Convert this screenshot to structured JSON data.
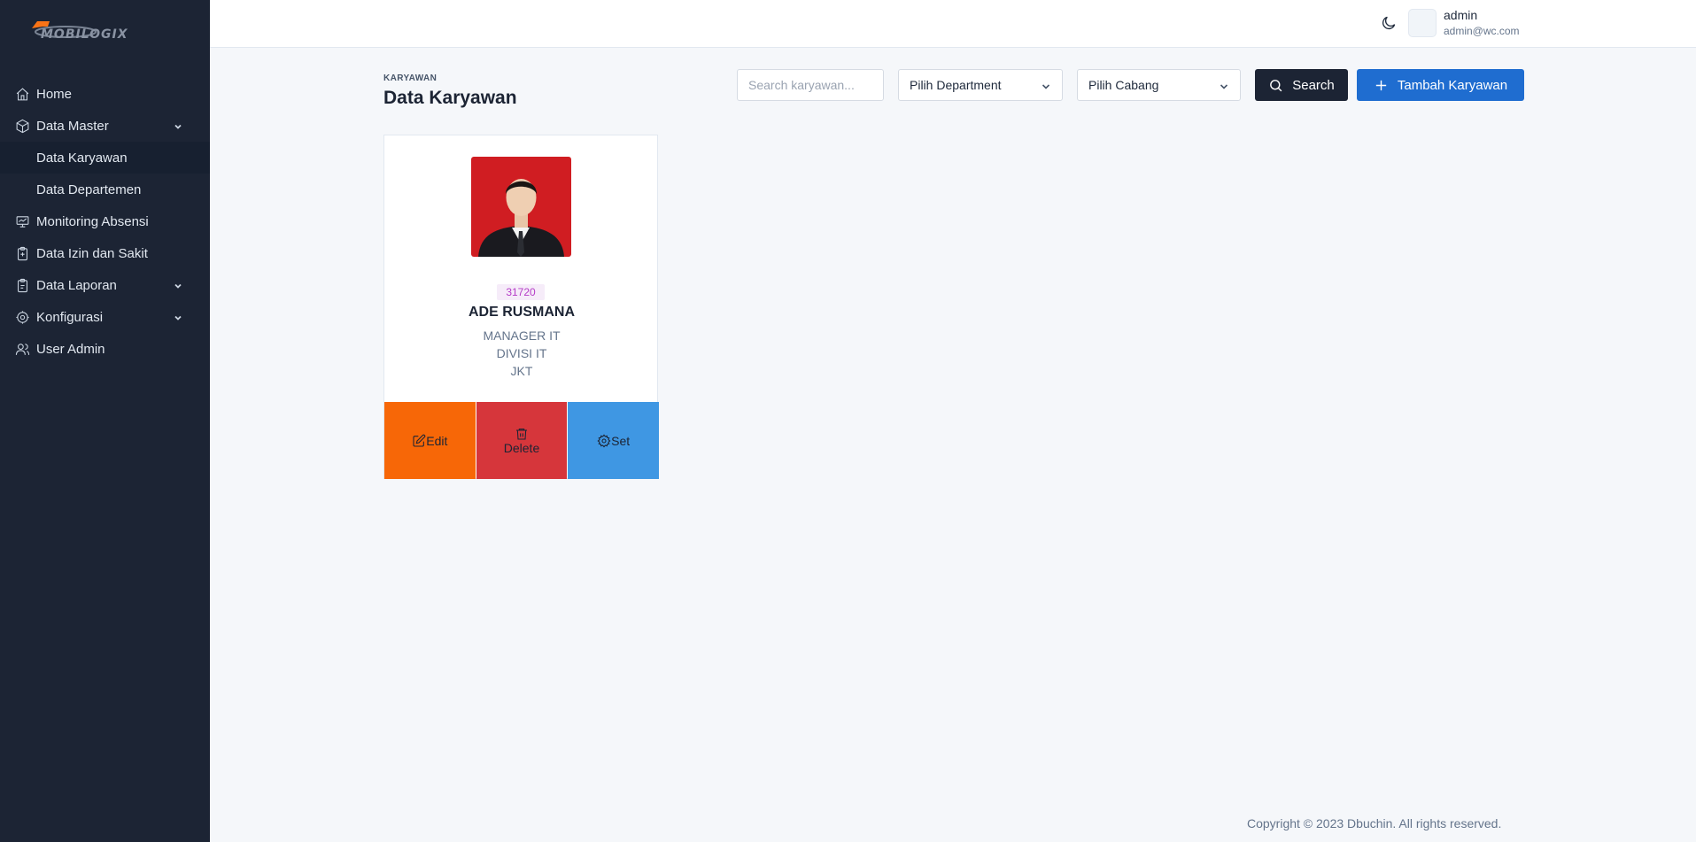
{
  "brand": {
    "logo_text": "MOBILOGIX"
  },
  "sidebar": {
    "items": [
      {
        "label": "Home",
        "icon": "home-icon"
      },
      {
        "label": "Data Master",
        "icon": "cube-icon",
        "expandable": true
      },
      {
        "label": "Data Karyawan",
        "sub": true,
        "active": true
      },
      {
        "label": "Data Departemen",
        "sub": true
      },
      {
        "label": "Monitoring Absensi",
        "icon": "monitor-icon"
      },
      {
        "label": "Data Izin dan Sakit",
        "icon": "clipboard-icon"
      },
      {
        "label": "Data Laporan",
        "icon": "clipboard-icon",
        "expandable": true
      },
      {
        "label": "Konfigurasi",
        "icon": "settings-icon",
        "expandable": true
      },
      {
        "label": "User Admin",
        "icon": "users-icon"
      }
    ]
  },
  "header": {
    "user_name": "admin",
    "user_email": "admin@wc.com"
  },
  "page": {
    "breadcrumb": "KARYAWAN",
    "title": "Data Karyawan"
  },
  "toolbar": {
    "search_placeholder": "Search karyawan...",
    "department_select": "Pilih Department",
    "cabang_select": "Pilih Cabang",
    "search_label": "Search",
    "add_label": "Tambah Karyawan"
  },
  "employee": {
    "id": "31720",
    "name": "ADE RUSMANA",
    "position": "MANAGER IT",
    "division": "DIVISI IT",
    "branch": "JKT"
  },
  "card_actions": {
    "edit": "Edit",
    "delete": "Delete",
    "set": "Set"
  },
  "footer": {
    "text": "Copyright © 2023 Dbuchin. All rights reserved."
  },
  "colors": {
    "sidebar": "#1c2434",
    "primary": "#1f6dd0",
    "edit": "#f76707",
    "delete": "#d6363b",
    "set": "#3f97e3",
    "id_badge": "#b53cc7"
  }
}
